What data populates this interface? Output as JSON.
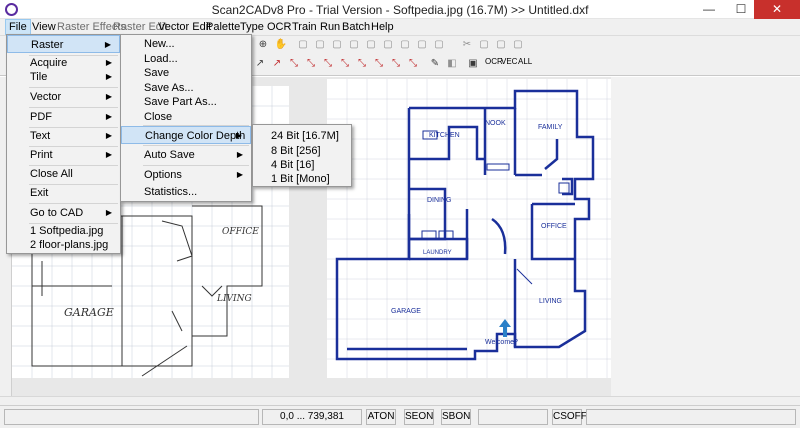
{
  "window": {
    "title": "Scan2CADv8 Pro - Trial Version  -  Softpedia.jpg (16.7M) >> Untitled.dxf",
    "minimize": "—",
    "maximize": "☐",
    "close": "✕"
  },
  "menubar": [
    "File",
    "View",
    "Raster Effects",
    "Raster Edit",
    "Vector Edit",
    "Palette",
    "Type",
    "OCR",
    "Train",
    "Run",
    "Batch",
    "Help"
  ],
  "toolbar": {
    "ocr_labels": [
      "OCR",
      "VEC",
      "ALL"
    ]
  },
  "file_menu": {
    "items": [
      "Raster",
      "Acquire",
      "Tile",
      "Vector",
      "PDF",
      "Text",
      "Print",
      "Close All",
      "Exit",
      "Go to CAD",
      "1 Softpedia.jpg",
      "2 floor-plans.jpg"
    ]
  },
  "raster_menu": {
    "items": [
      "New...",
      "Load...",
      "Save",
      "Save As...",
      "Save Part As...",
      "Close",
      "Change Color Depth",
      "Auto Save",
      "Options",
      "Statistics..."
    ]
  },
  "color_depth_menu": {
    "items": [
      "24 Bit [16.7M]",
      "8 Bit [256]",
      "4 Bit [16]",
      "1 Bit [Mono]"
    ]
  },
  "floorplan": {
    "rooms": [
      "KITCHEN",
      "NOOK",
      "FAMILY",
      "DINING",
      "OFFICE",
      "LAUNDRY",
      "GARAGE",
      "LIVING"
    ],
    "welcome": "Welcome?"
  },
  "scan_labels": [
    "OFFICE",
    "LIVING",
    "GARAGE"
  ],
  "status": {
    "coords": "0,0 ... 739,381",
    "cells": [
      "ATON",
      "SEON",
      "SBON",
      "CSOFF"
    ]
  },
  "colors": {
    "plan_blue": "#1a2f9a",
    "menu_highlight": "#d1e4f6",
    "close_red": "#c8302c"
  }
}
